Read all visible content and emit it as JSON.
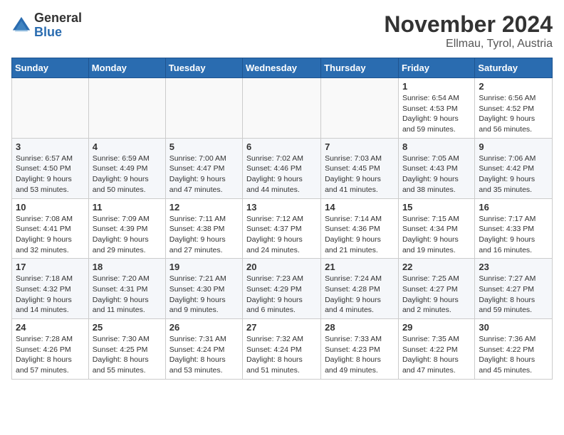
{
  "header": {
    "logo_general": "General",
    "logo_blue": "Blue",
    "month_title": "November 2024",
    "location": "Ellmau, Tyrol, Austria"
  },
  "weekdays": [
    "Sunday",
    "Monday",
    "Tuesday",
    "Wednesday",
    "Thursday",
    "Friday",
    "Saturday"
  ],
  "weeks": [
    [
      {
        "day": "",
        "detail": ""
      },
      {
        "day": "",
        "detail": ""
      },
      {
        "day": "",
        "detail": ""
      },
      {
        "day": "",
        "detail": ""
      },
      {
        "day": "",
        "detail": ""
      },
      {
        "day": "1",
        "detail": "Sunrise: 6:54 AM\nSunset: 4:53 PM\nDaylight: 9 hours and 59 minutes."
      },
      {
        "day": "2",
        "detail": "Sunrise: 6:56 AM\nSunset: 4:52 PM\nDaylight: 9 hours and 56 minutes."
      }
    ],
    [
      {
        "day": "3",
        "detail": "Sunrise: 6:57 AM\nSunset: 4:50 PM\nDaylight: 9 hours and 53 minutes."
      },
      {
        "day": "4",
        "detail": "Sunrise: 6:59 AM\nSunset: 4:49 PM\nDaylight: 9 hours and 50 minutes."
      },
      {
        "day": "5",
        "detail": "Sunrise: 7:00 AM\nSunset: 4:47 PM\nDaylight: 9 hours and 47 minutes."
      },
      {
        "day": "6",
        "detail": "Sunrise: 7:02 AM\nSunset: 4:46 PM\nDaylight: 9 hours and 44 minutes."
      },
      {
        "day": "7",
        "detail": "Sunrise: 7:03 AM\nSunset: 4:45 PM\nDaylight: 9 hours and 41 minutes."
      },
      {
        "day": "8",
        "detail": "Sunrise: 7:05 AM\nSunset: 4:43 PM\nDaylight: 9 hours and 38 minutes."
      },
      {
        "day": "9",
        "detail": "Sunrise: 7:06 AM\nSunset: 4:42 PM\nDaylight: 9 hours and 35 minutes."
      }
    ],
    [
      {
        "day": "10",
        "detail": "Sunrise: 7:08 AM\nSunset: 4:41 PM\nDaylight: 9 hours and 32 minutes."
      },
      {
        "day": "11",
        "detail": "Sunrise: 7:09 AM\nSunset: 4:39 PM\nDaylight: 9 hours and 29 minutes."
      },
      {
        "day": "12",
        "detail": "Sunrise: 7:11 AM\nSunset: 4:38 PM\nDaylight: 9 hours and 27 minutes."
      },
      {
        "day": "13",
        "detail": "Sunrise: 7:12 AM\nSunset: 4:37 PM\nDaylight: 9 hours and 24 minutes."
      },
      {
        "day": "14",
        "detail": "Sunrise: 7:14 AM\nSunset: 4:36 PM\nDaylight: 9 hours and 21 minutes."
      },
      {
        "day": "15",
        "detail": "Sunrise: 7:15 AM\nSunset: 4:34 PM\nDaylight: 9 hours and 19 minutes."
      },
      {
        "day": "16",
        "detail": "Sunrise: 7:17 AM\nSunset: 4:33 PM\nDaylight: 9 hours and 16 minutes."
      }
    ],
    [
      {
        "day": "17",
        "detail": "Sunrise: 7:18 AM\nSunset: 4:32 PM\nDaylight: 9 hours and 14 minutes."
      },
      {
        "day": "18",
        "detail": "Sunrise: 7:20 AM\nSunset: 4:31 PM\nDaylight: 9 hours and 11 minutes."
      },
      {
        "day": "19",
        "detail": "Sunrise: 7:21 AM\nSunset: 4:30 PM\nDaylight: 9 hours and 9 minutes."
      },
      {
        "day": "20",
        "detail": "Sunrise: 7:23 AM\nSunset: 4:29 PM\nDaylight: 9 hours and 6 minutes."
      },
      {
        "day": "21",
        "detail": "Sunrise: 7:24 AM\nSunset: 4:28 PM\nDaylight: 9 hours and 4 minutes."
      },
      {
        "day": "22",
        "detail": "Sunrise: 7:25 AM\nSunset: 4:27 PM\nDaylight: 9 hours and 2 minutes."
      },
      {
        "day": "23",
        "detail": "Sunrise: 7:27 AM\nSunset: 4:27 PM\nDaylight: 8 hours and 59 minutes."
      }
    ],
    [
      {
        "day": "24",
        "detail": "Sunrise: 7:28 AM\nSunset: 4:26 PM\nDaylight: 8 hours and 57 minutes."
      },
      {
        "day": "25",
        "detail": "Sunrise: 7:30 AM\nSunset: 4:25 PM\nDaylight: 8 hours and 55 minutes."
      },
      {
        "day": "26",
        "detail": "Sunrise: 7:31 AM\nSunset: 4:24 PM\nDaylight: 8 hours and 53 minutes."
      },
      {
        "day": "27",
        "detail": "Sunrise: 7:32 AM\nSunset: 4:24 PM\nDaylight: 8 hours and 51 minutes."
      },
      {
        "day": "28",
        "detail": "Sunrise: 7:33 AM\nSunset: 4:23 PM\nDaylight: 8 hours and 49 minutes."
      },
      {
        "day": "29",
        "detail": "Sunrise: 7:35 AM\nSunset: 4:22 PM\nDaylight: 8 hours and 47 minutes."
      },
      {
        "day": "30",
        "detail": "Sunrise: 7:36 AM\nSunset: 4:22 PM\nDaylight: 8 hours and 45 minutes."
      }
    ]
  ]
}
